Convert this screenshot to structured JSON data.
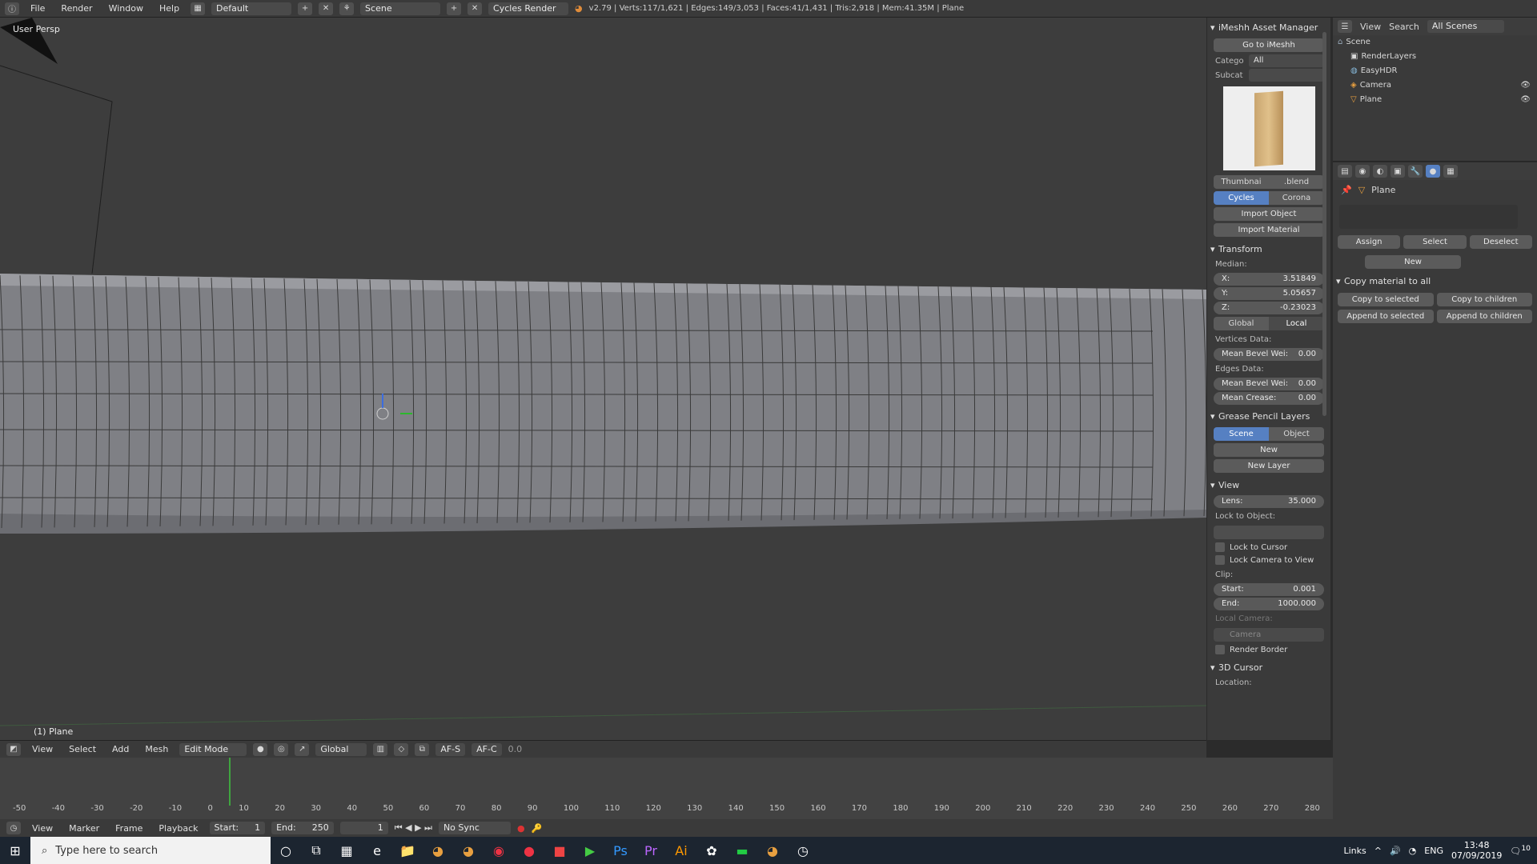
{
  "topbar": {
    "menus": [
      "File",
      "Render",
      "Window",
      "Help"
    ],
    "layout": "Default",
    "scene": "Scene",
    "engine": "Cycles Render",
    "stats": "v2.79 | Verts:117/1,621 | Edges:149/3,053 | Faces:41/1,431 | Tris:2,918 | Mem:41.35M | Plane"
  },
  "viewport": {
    "view_label": "User Persp",
    "object_label": "(1) Plane"
  },
  "viewport_header": {
    "menus": [
      "View",
      "Select",
      "Add",
      "Mesh"
    ],
    "mode": "Edit Mode",
    "orientation": "Global",
    "af_s": "AF-S",
    "af_c": "AF-C",
    "value": "0.0"
  },
  "npanel": {
    "imeshh": {
      "title": "iMeshh Asset Manager",
      "goto": "Go to iMeshh",
      "categ_label": "Catego",
      "categ_value": "All",
      "subcat_label": "Subcat",
      "thumbnail_btn": "Thumbnai",
      "blend_btn": ".blend",
      "cycles": "Cycles",
      "corona": "Corona",
      "import_object": "Import Object",
      "import_material": "Import Material"
    },
    "transform": {
      "title": "Transform",
      "median": "Median:",
      "x_label": "X:",
      "x": "3.51849",
      "y_label": "Y:",
      "y": "5.05657",
      "z_label": "Z:",
      "z": "-0.23023",
      "global": "Global",
      "local": "Local",
      "vertices_data": "Vertices Data:",
      "mean_bevel_v_label": "Mean Bevel Wei:",
      "mean_bevel_v": "0.00",
      "edges_data": "Edges Data:",
      "mean_bevel_e_label": "Mean Bevel Wei:",
      "mean_bevel_e": "0.00",
      "mean_crease_label": "Mean Crease:",
      "mean_crease": "0.00"
    },
    "grease": {
      "title": "Grease Pencil Layers",
      "scene": "Scene",
      "object": "Object",
      "new": "New",
      "new_layer": "New Layer"
    },
    "view": {
      "title": "View",
      "lens_label": "Lens:",
      "lens": "35.000",
      "lock_to_object": "Lock to Object:",
      "lock_to_cursor": "Lock to Cursor",
      "lock_camera": "Lock Camera to View",
      "clip": "Clip:",
      "start_label": "Start:",
      "start": "0.001",
      "end_label": "End:",
      "end": "1000.000",
      "local_camera": "Local Camera:",
      "camera": "Camera",
      "render_border": "Render Border"
    },
    "cursor": {
      "title": "3D Cursor",
      "location": "Location:"
    }
  },
  "outliner": {
    "view": "View",
    "search": "Search",
    "filter": "All Scenes",
    "items": [
      "Scene",
      "RenderLayers",
      "EasyHDR",
      "Camera",
      "Plane"
    ]
  },
  "properties": {
    "object": "Plane",
    "assign": "Assign",
    "select": "Select",
    "deselect": "Deselect",
    "new": "New",
    "copy_material_title": "Copy material to all",
    "copy_to_selected": "Copy to selected",
    "copy_to_children": "Copy to children",
    "append_to_selected": "Append to selected",
    "append_to_children": "Append to children"
  },
  "timeline": {
    "ticks": [
      "-50",
      "-40",
      "-30",
      "-20",
      "-10",
      "0",
      "10",
      "20",
      "30",
      "40",
      "50",
      "60",
      "70",
      "80",
      "90",
      "100",
      "110",
      "120",
      "130",
      "140",
      "150",
      "160",
      "170",
      "180",
      "190",
      "200",
      "210",
      "220",
      "230",
      "240",
      "250",
      "260",
      "270",
      "280"
    ],
    "menus": [
      "View",
      "Marker",
      "Frame",
      "Playback"
    ],
    "start_label": "Start:",
    "start": "1",
    "end_label": "End:",
    "end": "250",
    "current": "1",
    "sync": "No Sync"
  },
  "taskbar": {
    "search_placeholder": "Type here to search",
    "links": "Links",
    "lang": "ENG",
    "time": "13:48",
    "date": "07/09/2019",
    "notif": "10"
  }
}
